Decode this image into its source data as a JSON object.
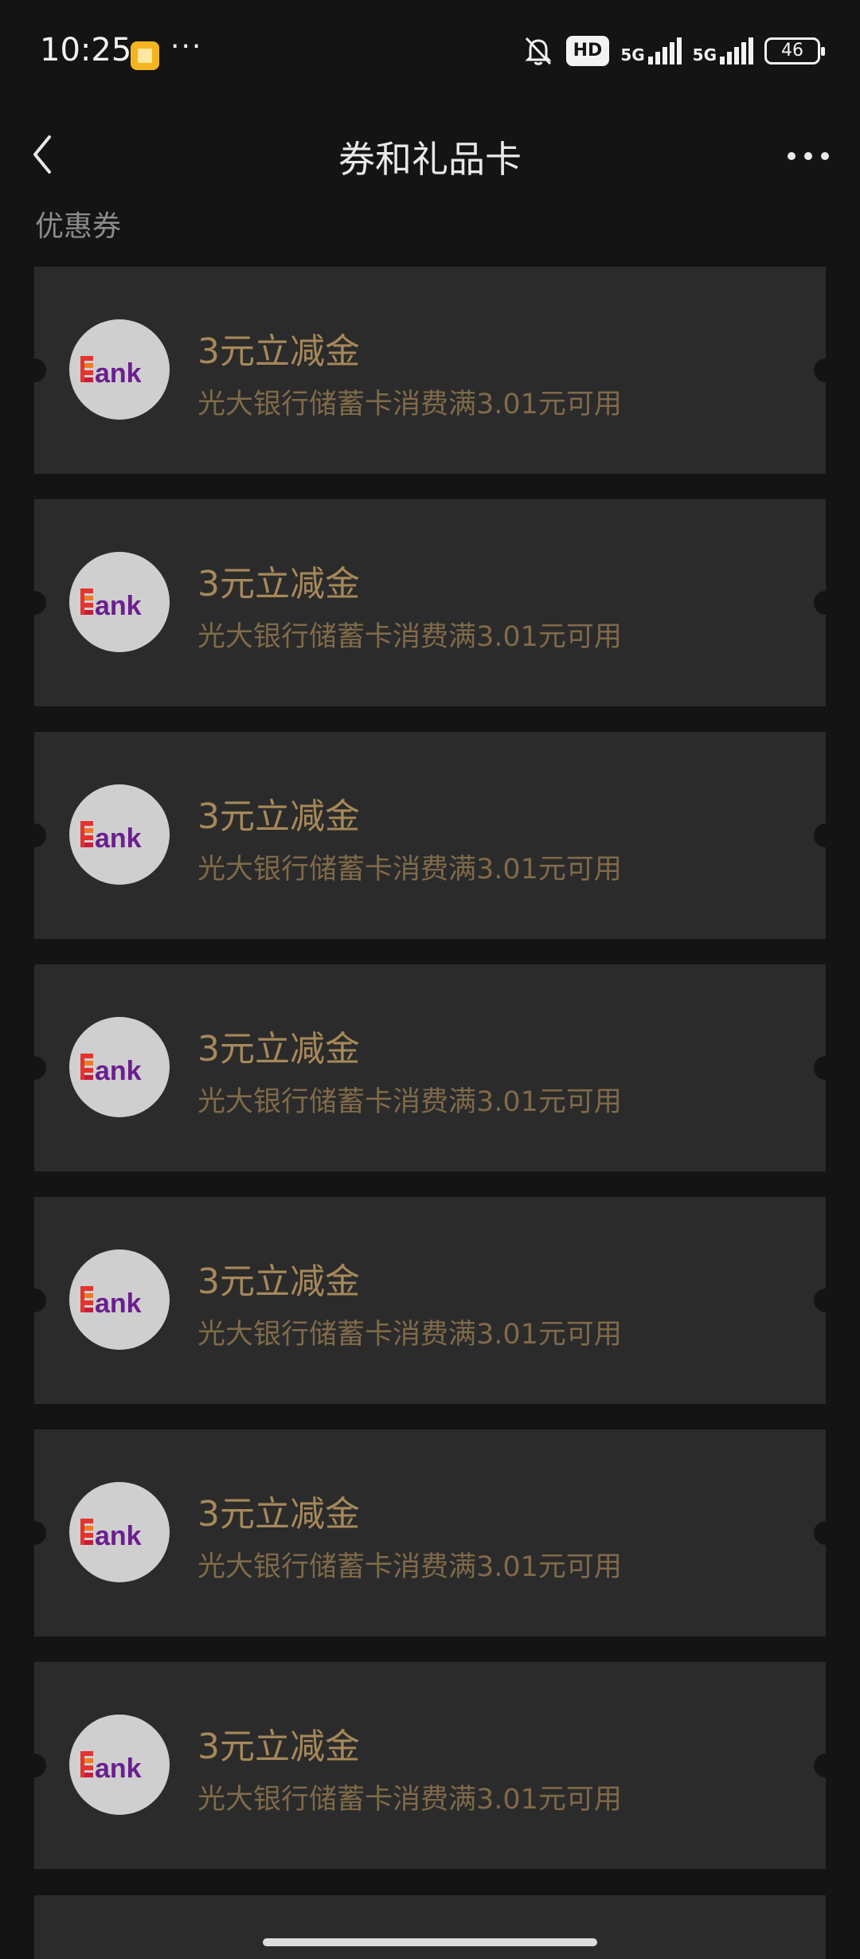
{
  "status_bar": {
    "time": "10:25",
    "dots": "···",
    "hd": "HD",
    "network_1": "5G",
    "network_2": "5G",
    "battery": "46"
  },
  "nav": {
    "title": "券和礼品卡"
  },
  "section": {
    "title": "优惠券"
  },
  "coupons": [
    {
      "title": "3元立减金",
      "desc": "光大银行储蓄卡消费满3.01元可用",
      "logo_text": "ank"
    },
    {
      "title": "3元立减金",
      "desc": "光大银行储蓄卡消费满3.01元可用",
      "logo_text": "ank"
    },
    {
      "title": "3元立减金",
      "desc": "光大银行储蓄卡消费满3.01元可用",
      "logo_text": "ank"
    },
    {
      "title": "3元立减金",
      "desc": "光大银行储蓄卡消费满3.01元可用",
      "logo_text": "ank"
    },
    {
      "title": "3元立减金",
      "desc": "光大银行储蓄卡消费满3.01元可用",
      "logo_text": "ank"
    },
    {
      "title": "3元立减金",
      "desc": "光大银行储蓄卡消费满3.01元可用",
      "logo_text": "ank"
    },
    {
      "title": "3元立减金",
      "desc": "光大银行储蓄卡消费满3.01元可用",
      "logo_text": "ank"
    }
  ],
  "colors": {
    "background": "#141414",
    "card": "#2b2b2b",
    "coupon_title": "#a6885a",
    "coupon_desc": "#7f6a4a",
    "logo_red": "#e3342f",
    "logo_purple": "#6b1f8f"
  },
  "icons": {
    "back": "chevron-left-icon",
    "more": "more-dots-icon",
    "mute": "bell-muted-icon",
    "logo": "bank-logo-icon"
  }
}
